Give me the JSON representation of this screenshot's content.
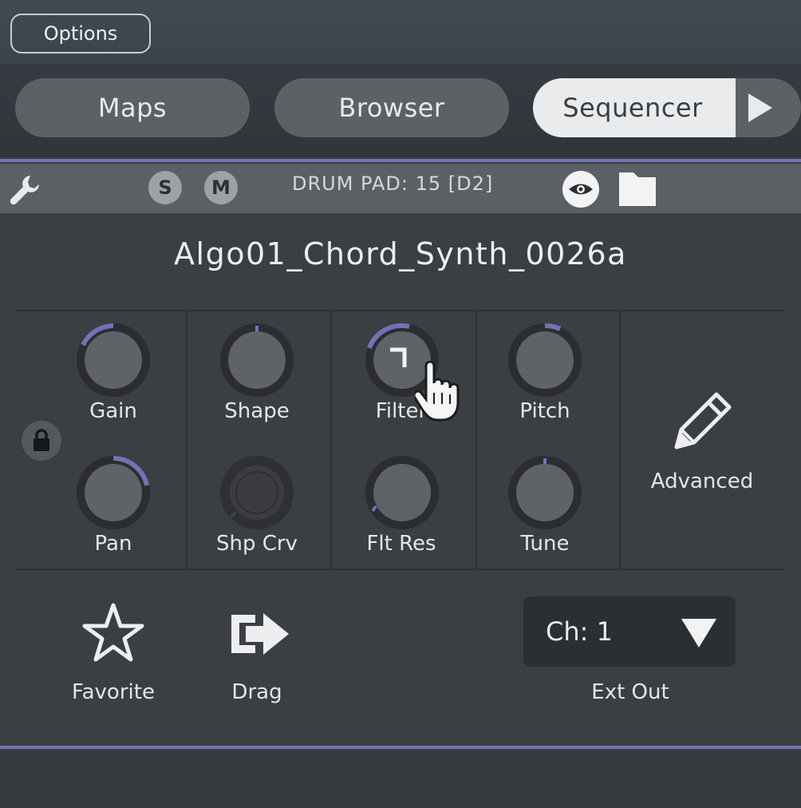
{
  "header": {
    "options_label": "Options"
  },
  "tabs": {
    "maps": "Maps",
    "browser": "Browser",
    "sequencer": "Sequencer"
  },
  "toolstrip": {
    "solo": "S",
    "mute": "M",
    "pad_label": "DRUM PAD: 15 [D2]"
  },
  "preset": {
    "name": "Algo01_Chord_Synth_0026a"
  },
  "knobs": {
    "gain": "Gain",
    "pan": "Pan",
    "shape": "Shape",
    "shp_crv": "Shp Crv",
    "filter": "Filter",
    "flt_res": "Flt Res",
    "pitch": "Pitch",
    "tune": "Tune"
  },
  "advanced": {
    "label": "Advanced"
  },
  "footer": {
    "favorite": "Favorite",
    "drag": "Drag",
    "channel_value": "Ch: 1",
    "ext_out": "Ext Out"
  },
  "colors": {
    "accent": "#6f74b5",
    "knob_body": "#5f6266",
    "panel": "#3b3e42"
  }
}
